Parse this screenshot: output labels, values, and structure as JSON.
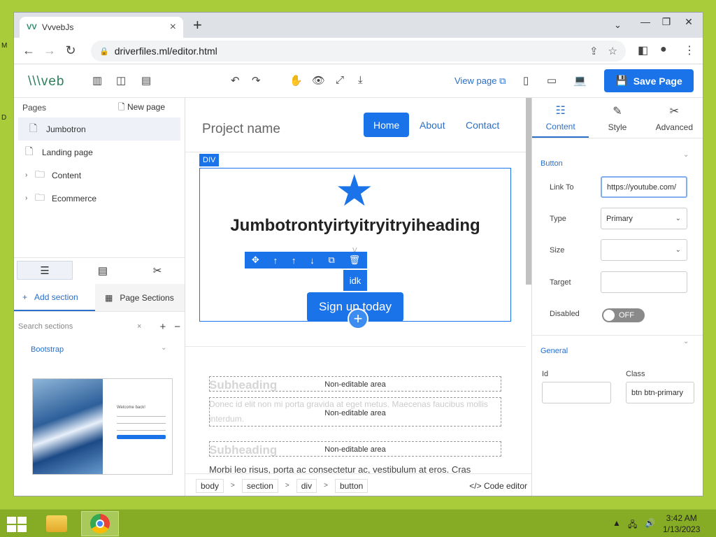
{
  "desktop": {
    "frag1": "M",
    "frag2": "D"
  },
  "browser": {
    "tab_title": "VvvebJs",
    "favicon": "VV",
    "url": "driverfiles.ml/editor.html"
  },
  "editor": {
    "logo": "\\\\\\veb",
    "view_page": "View page",
    "save_page": "Save Page",
    "pages_label": "Pages",
    "new_page": "New page",
    "pages": [
      {
        "label": "Jumbotron"
      },
      {
        "label": "Landing page"
      },
      {
        "label": "Content"
      },
      {
        "label": "Ecommerce"
      }
    ],
    "add_section": "Add section",
    "page_sections": "Page Sections",
    "search_placeholder": "Search sections",
    "bootstrap": "Bootstrap",
    "thumb_welcome": "Welcome back!"
  },
  "canvas": {
    "brand": "Project name",
    "nav": [
      "Home",
      "About",
      "Contact"
    ],
    "div_label": "DIV",
    "heading": "Jumbotrontyirtyitryitryiheading",
    "v_mark": "V",
    "idk": "idk",
    "signup": "Sign up today",
    "non_editable": "Non-editable area",
    "subheading": "Subheading",
    "ghost_para": "Donec id elit non mi porta gravida at eget metus. Maecenas faucibus mollis interdum.",
    "lorem": "Morbi leo risus, porta ac consectetur ac, vestibulum at eros. Cras"
  },
  "breadcrumbs": [
    "body",
    "section",
    "div",
    "button"
  ],
  "code_editor": "Code editor",
  "properties": {
    "tabs": [
      "Content",
      "Style",
      "Advanced"
    ],
    "group_button": "Button",
    "link_to_label": "Link To",
    "link_to_value": "https://youtube.com/",
    "type_label": "Type",
    "type_value": "Primary",
    "size_label": "Size",
    "size_value": "",
    "target_label": "Target",
    "target_value": "",
    "disabled_label": "Disabled",
    "disabled_value": "OFF",
    "group_general": "General",
    "id_label": "Id",
    "id_value": "",
    "class_label": "Class",
    "class_value": "btn btn-primary"
  },
  "taskbar": {
    "time": "3:42 AM",
    "date": "1/13/2023"
  },
  "colors": {
    "accent": "#1a73e8",
    "desktop": "#a8cc3a",
    "taskbar": "#86ab24"
  }
}
